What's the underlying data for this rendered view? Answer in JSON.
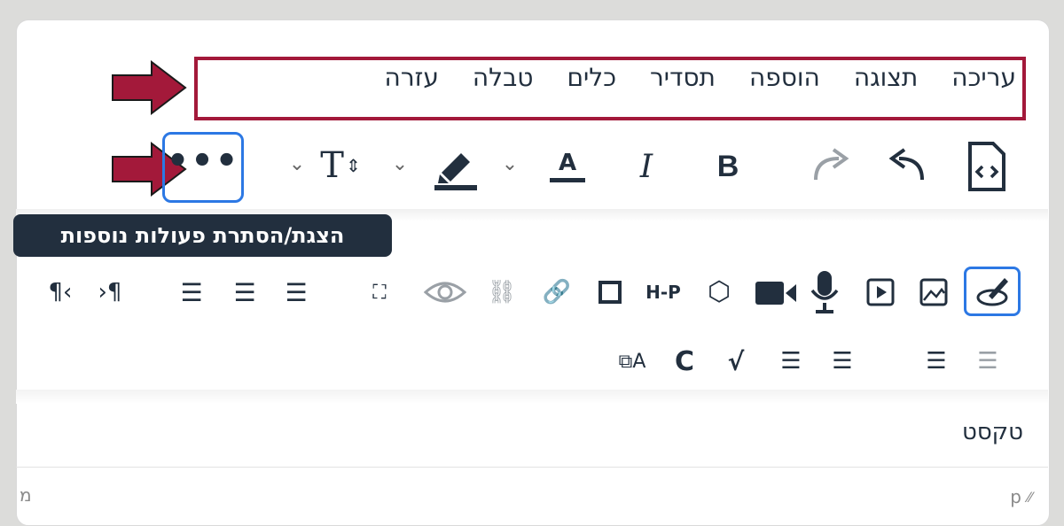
{
  "menubar": {
    "items": [
      "עריכה",
      "תצוגה",
      "הוספה",
      "תסדיר",
      "כלים",
      "טבלה",
      "עזרה"
    ]
  },
  "toolbar": {
    "more_label": "•••",
    "source_code_icon": "source-code-icon",
    "undo_icon": "undo-icon",
    "redo_icon": "redo-icon",
    "bold_label": "B",
    "italic_label": "I",
    "text_color_label": "A",
    "font_size_label": "T"
  },
  "tooltip": {
    "text": "הצגת/הסתרת פעולות נוספות"
  },
  "content": {
    "text": "טקסט"
  },
  "statusbar": {
    "left": "מ",
    "right": "p"
  },
  "colors": {
    "highlight_border": "#a3193a",
    "arrow_fill": "#a3193a",
    "focus_blue": "#2c78e4",
    "icon_dark": "#222f3e"
  }
}
